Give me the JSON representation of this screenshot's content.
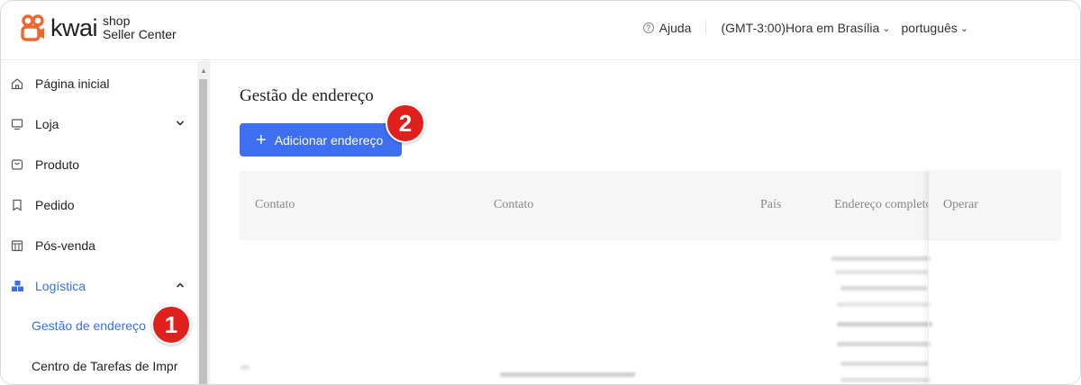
{
  "header": {
    "logo_word": "kwai",
    "logo_sub_top": "shop",
    "logo_sub_bottom": "Seller Center",
    "help_label": "Ajuda",
    "timezone_label": "(GMT-3:00)Hora em Brasília",
    "language_label": "português",
    "brand_color": "#f3652b"
  },
  "sidebar": {
    "items": [
      {
        "label": "Página inicial",
        "icon": "home-icon"
      },
      {
        "label": "Loja",
        "icon": "monitor-icon",
        "expanded": false
      },
      {
        "label": "Produto",
        "icon": "bag-icon"
      },
      {
        "label": "Pedido",
        "icon": "bookmark-icon"
      },
      {
        "label": "Pós-venda",
        "icon": "box-icon"
      },
      {
        "label": "Logística",
        "icon": "logistics-icon",
        "expanded": true
      }
    ],
    "sub_items": [
      {
        "label": "Gestão de endereço",
        "active": true
      },
      {
        "label": "Centro de Tarefas de Impr"
      }
    ],
    "accent_color": "#3c6ee0"
  },
  "main": {
    "page_title": "Gestão de endereço",
    "add_button_label": "Adicionar endereço",
    "columns": [
      "Contato",
      "Contato",
      "País",
      "Endereço completo",
      "Operar"
    ]
  },
  "steps": {
    "step1": "1",
    "step2": "2",
    "color": "#e0201d"
  }
}
